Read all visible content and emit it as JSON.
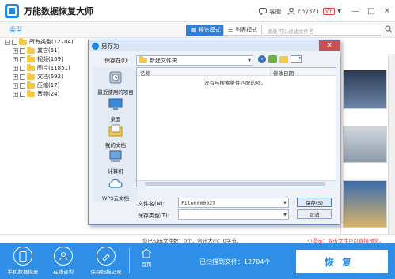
{
  "app": {
    "title": "万能数据恢复大师",
    "service_label": "客服",
    "username": "chy321",
    "vip_badge": "VIP",
    "win_minimize": "—",
    "win_maximize": "□",
    "win_close": "✕"
  },
  "toolbar": {
    "breadcrumb": "类型",
    "preview_mode": "预览模式",
    "list_mode": "列表模式",
    "filter_placeholder": "此处可以过滤文件名"
  },
  "tree": {
    "root": "所有类型(12704)",
    "items": [
      {
        "label": "其它(51)"
      },
      {
        "label": "视频(169)"
      },
      {
        "label": "图片(11851)"
      },
      {
        "label": "文档(592)"
      },
      {
        "label": "压缩(17)"
      },
      {
        "label": "音频(24)"
      }
    ]
  },
  "status": {
    "selected": "您已勾选文件数：0个，合计大小：0字节。",
    "hint": "小提示：双击文件可以直接预览。"
  },
  "bottom": {
    "btn_phone": "手机数据恢复",
    "btn_online": "在线咨询",
    "btn_save": "保存扫描记录",
    "home": "首页",
    "scanned": "已扫描到文件：12704个",
    "recover": "恢复"
  },
  "dialog": {
    "title": "另存为",
    "save_in_label": "保存在(I):",
    "save_in_value": "新建文件夹",
    "places": [
      {
        "label": "最近使用的项目",
        "icon": "recent-icon"
      },
      {
        "label": "桌面",
        "icon": "desktop-icon"
      },
      {
        "label": "我的文档",
        "icon": "documents-icon"
      },
      {
        "label": "计算机",
        "icon": "computer-icon"
      },
      {
        "label": "WPS云文档",
        "icon": "cloud-icon"
      }
    ],
    "col_name": "名称",
    "col_modified": "修改日期",
    "empty_message": "没有与搜索条件匹配的项。",
    "filename_label": "文件名(N):",
    "filename_value": "File000092T",
    "filetype_label": "保存类型(T):",
    "filetype_value": "",
    "save_button": "保存(S)",
    "cancel_button": "取消"
  },
  "colors": {
    "accent": "#2f8ee5",
    "warning": "#e53935"
  }
}
